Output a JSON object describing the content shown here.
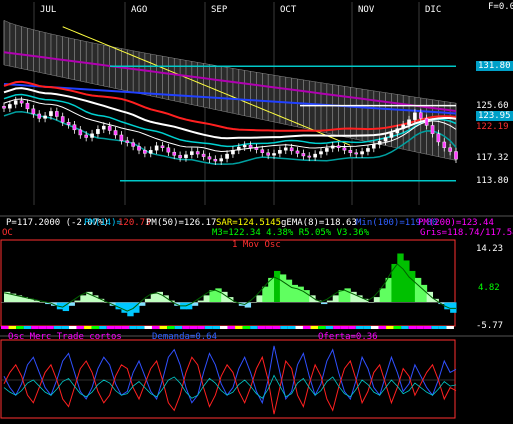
{
  "corner_label": "F=0.0",
  "months": [
    "JUL",
    "AGO",
    "SEP",
    "OCT",
    "NOV",
    "DIC"
  ],
  "price_panel": {
    "right_labels": [
      {
        "text": "131.80",
        "y": 131.8,
        "color": "#00c8ff",
        "box": true
      },
      {
        "text": "125.60",
        "y": 125.6,
        "color": "#ffffff",
        "box": false
      },
      {
        "text": "123.95",
        "y": 123.95,
        "color": "#00c8ff",
        "box": true
      },
      {
        "text": "122.19",
        "y": 122.19,
        "color": "#ff3030",
        "box": false
      },
      {
        "text": "117.32",
        "y": 117.32,
        "color": "#ffffff",
        "box": false
      },
      {
        "text": "113.80",
        "y": 113.8,
        "color": "#ffffff",
        "box": false
      }
    ],
    "info_row1": [
      {
        "text": "P=117.2000 (-2.07%)",
        "color": "#ffffff"
      },
      {
        "text": "PM(14)=",
        "color": "#00c8ff"
      },
      {
        "text": "120.73",
        "color": "#ff3030"
      },
      {
        "text": "PM(50)=126.17",
        "color": "#ffffff"
      },
      {
        "text": "SAR=124.5145",
        "color": "#ffff00"
      },
      {
        "text": "gEMA(8)=118.63",
        "color": "#ffffff"
      },
      {
        "text": "Min(100)=119.80",
        "color": "#3060ff"
      },
      {
        "text": "PM(200)=123.44",
        "color": "#ff00ff"
      }
    ],
    "info_row2": [
      {
        "text": "OC",
        "color": "#ff3030"
      },
      {
        "text": "M3=122.34 4.38% R5.05% V3.36%",
        "color": "#00ff00"
      },
      {
        "text": "Gris=118.74/117.58",
        "color": "#ff00ff"
      }
    ]
  },
  "macd_panel": {
    "title": "1 Mov Osc",
    "ticks": [
      "14.23",
      "4.82",
      "-5.77"
    ]
  },
  "osc_panel": {
    "labels": [
      {
        "text": "Osc Merc Trade cortos",
        "color": "#ff00ff"
      },
      {
        "text": "Demanda=0.64",
        "color": "#3060ff"
      },
      {
        "text": "Oferta=0.36",
        "color": "#ff00ff"
      }
    ]
  },
  "chart_data": {
    "type": "line",
    "price": {
      "ylim": [
        110,
        140
      ],
      "close": [
        125.2,
        125.8,
        126.4,
        126.0,
        125.1,
        124.3,
        123.6,
        124.0,
        124.7,
        123.9,
        123.0,
        122.6,
        121.8,
        121.0,
        120.6,
        121.2,
        121.9,
        122.4,
        121.7,
        121.0,
        120.1,
        119.8,
        119.2,
        118.6,
        118.1,
        118.6,
        119.3,
        119.0,
        118.3,
        117.8,
        117.4,
        117.9,
        118.4,
        118.0,
        117.6,
        117.2,
        116.9,
        117.3,
        118.0,
        118.6,
        119.1,
        119.4,
        119.0,
        118.7,
        118.2,
        117.8,
        118.1,
        118.6,
        119.0,
        118.5,
        118.1,
        117.7,
        117.5,
        118.0,
        118.4,
        118.9,
        119.3,
        119.0,
        118.6,
        118.2,
        118.0,
        118.4,
        118.9,
        119.5,
        120.0,
        120.6,
        121.3,
        122.0,
        122.6,
        123.4,
        124.5,
        123.6,
        122.5,
        121.2,
        119.9,
        119.0,
        118.4,
        117.2
      ]
    },
    "macd": {
      "ylim": [
        -6.5,
        15
      ],
      "values": [
        3,
        2.5,
        2,
        1.5,
        1,
        0.5,
        0,
        -0.5,
        -1,
        -2,
        -2.5,
        -1,
        0.5,
        2,
        3,
        2,
        1,
        0,
        -1,
        -2,
        -3,
        -4,
        -3,
        -1,
        1,
        2.5,
        3,
        2,
        0.5,
        -1,
        -2,
        -2,
        -1,
        0.5,
        2,
        3.5,
        4,
        3,
        1.5,
        0,
        -1,
        -1.5,
        0,
        2,
        4.5,
        7,
        9,
        8,
        6.5,
        5,
        4.5,
        3.5,
        2,
        0.5,
        -0.5,
        0.5,
        2,
        3.5,
        4,
        3,
        2,
        1,
        0,
        1.5,
        4,
        7,
        11,
        14,
        12,
        9,
        7,
        5,
        3,
        1,
        -0.5,
        -2,
        -3,
        -3
      ]
    },
    "oscillator": {
      "ylim": [
        0,
        1
      ],
      "demanda": [
        0.55,
        0.4,
        0.3,
        0.45,
        0.7,
        0.8,
        0.6,
        0.4,
        0.3,
        0.5,
        0.75,
        0.85,
        0.6,
        0.35,
        0.25,
        0.4,
        0.65,
        0.8,
        0.7,
        0.45,
        0.3,
        0.35,
        0.6,
        0.75,
        0.55,
        0.35,
        0.25,
        0.5,
        0.8,
        0.9,
        0.7,
        0.4,
        0.2,
        0.3,
        0.6,
        0.85,
        0.7,
        0.45,
        0.3,
        0.4,
        0.65,
        0.8,
        0.6,
        0.35,
        0.2,
        0.5,
        0.95,
        0.6,
        0.25,
        0.35,
        0.7,
        0.85,
        0.55,
        0.3,
        0.45,
        0.75,
        0.9,
        0.6,
        0.35,
        0.25,
        0.5,
        0.8,
        0.65,
        0.4,
        0.3,
        0.55,
        0.8,
        0.6,
        0.35,
        0.45,
        0.7,
        0.55,
        0.4,
        0.3,
        0.5,
        0.75,
        0.6,
        0.64
      ],
      "oferta": [
        0.45,
        0.6,
        0.7,
        0.55,
        0.3,
        0.2,
        0.4,
        0.6,
        0.7,
        0.5,
        0.25,
        0.15,
        0.4,
        0.65,
        0.75,
        0.6,
        0.35,
        0.2,
        0.3,
        0.55,
        0.7,
        0.65,
        0.4,
        0.25,
        0.45,
        0.65,
        0.75,
        0.5,
        0.2,
        0.1,
        0.3,
        0.6,
        0.8,
        0.7,
        0.4,
        0.15,
        0.3,
        0.55,
        0.7,
        0.6,
        0.35,
        0.2,
        0.4,
        0.65,
        0.8,
        0.5,
        0.05,
        0.4,
        0.75,
        0.65,
        0.3,
        0.15,
        0.45,
        0.7,
        0.55,
        0.25,
        0.1,
        0.4,
        0.65,
        0.75,
        0.5,
        0.2,
        0.35,
        0.6,
        0.7,
        0.45,
        0.2,
        0.4,
        0.65,
        0.55,
        0.3,
        0.45,
        0.6,
        0.7,
        0.5,
        0.25,
        0.4,
        0.36
      ]
    }
  }
}
